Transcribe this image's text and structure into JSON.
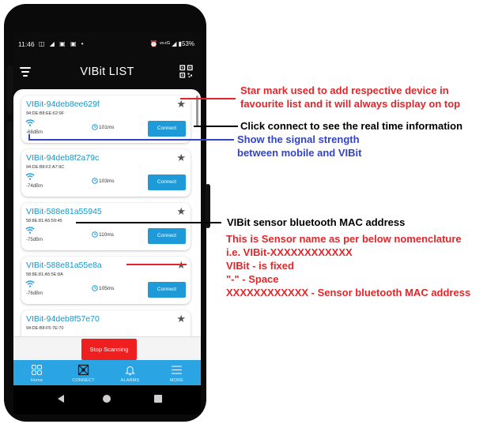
{
  "status_bar": {
    "time": "11:46",
    "icons": "◫ ◢ ▣ ▣ •",
    "right": "⏰ ᵛᵒ⁴ᴳ ◢ ▮53%"
  },
  "app_bar": {
    "title": "VIBit LIST"
  },
  "devices": [
    {
      "name": "VIBit-94deb8ee629f",
      "mac": "94:DE:B8:EE:62:9F",
      "rssi": "-68dBm",
      "interval": "101ms",
      "connect_label": "Connect"
    },
    {
      "name": "VIBit-94deb8f2a79c",
      "mac": "94:DE:B8:F2:A7:9C",
      "rssi": "-74dBm",
      "interval": "103ms",
      "connect_label": "Connect"
    },
    {
      "name": "VIBit-588e81a55945",
      "mac": "58:8E:81:A5:59:45",
      "rssi": "-75dBm",
      "interval": "110ms",
      "connect_label": "Connect"
    },
    {
      "name": "VIBit-588e81a55e8a",
      "mac": "58:8E:81:A5:5E:8A",
      "rssi": "-76dBm",
      "interval": "105ms",
      "connect_label": "Connect"
    },
    {
      "name": "VIBit-94deb8f57e70",
      "mac": "94:DE:B8:F5:7E:70"
    }
  ],
  "stop_scanning_label": "Stop Scanning",
  "bottom_nav": [
    {
      "label": "Home"
    },
    {
      "label": "CONNECT"
    },
    {
      "label": "ALARMS"
    },
    {
      "label": "MORE"
    }
  ],
  "annotations": {
    "star_line1": "Star mark used to add respective device in",
    "star_line2": "favourite list and it will always display on top",
    "connect": "Click connect to see the real time information",
    "signal_line1": "Show the signal strength",
    "signal_line2": "between mobile and VIBit",
    "mac": "VIBit sensor bluetooth MAC address",
    "name_line1": "This is Sensor name as per below nomenclature",
    "name_line2": "i.e. VIBit-XXXXXXXXXXXX",
    "name_line3": "VIBit - is fixed",
    "name_line4": "\"-\" - Space",
    "name_line5": "XXXXXXXXXXXX - Sensor bluetooth MAC address"
  },
  "colors": {
    "accent_blue": "#1e9ad8",
    "nav_blue": "#2aa4e3",
    "stop_red": "#ef1f1f",
    "annotation_red": "#e3262a",
    "annotation_blue": "#3344c4"
  }
}
